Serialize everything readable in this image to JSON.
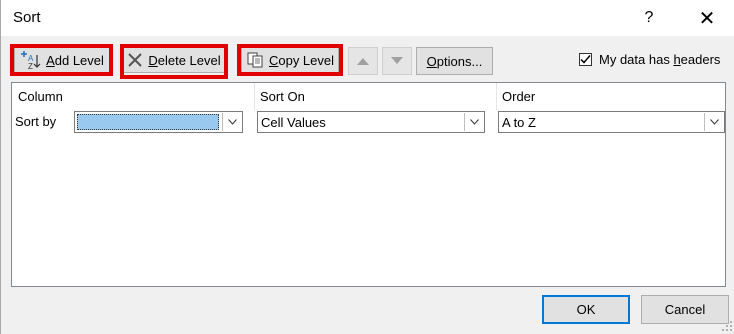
{
  "window": {
    "title": "Sort",
    "help_glyph": "?",
    "close_glyph": "✕"
  },
  "toolbar": {
    "add_level_underline": "A",
    "add_level_rest": "dd Level",
    "delete_level_underline": "D",
    "delete_level_rest": "elete Level",
    "copy_level_underline": "C",
    "copy_level_rest": "opy Level",
    "options_underline": "O",
    "options_rest": "ptions..."
  },
  "headers_checkbox": {
    "label_pre": "My data has ",
    "label_underline": "h",
    "label_post": "eaders",
    "checked": true
  },
  "columns": {
    "column": "Column",
    "sort_on": "Sort On",
    "order": "Order"
  },
  "row": {
    "label": "Sort by",
    "column_value": "",
    "sort_on_value": "Cell Values",
    "order_value": "A to Z"
  },
  "footer": {
    "ok": "OK",
    "cancel": "Cancel"
  },
  "colors": {
    "highlight": "#e10000",
    "selection": "#99c9ef",
    "default_border": "#0078d7"
  }
}
